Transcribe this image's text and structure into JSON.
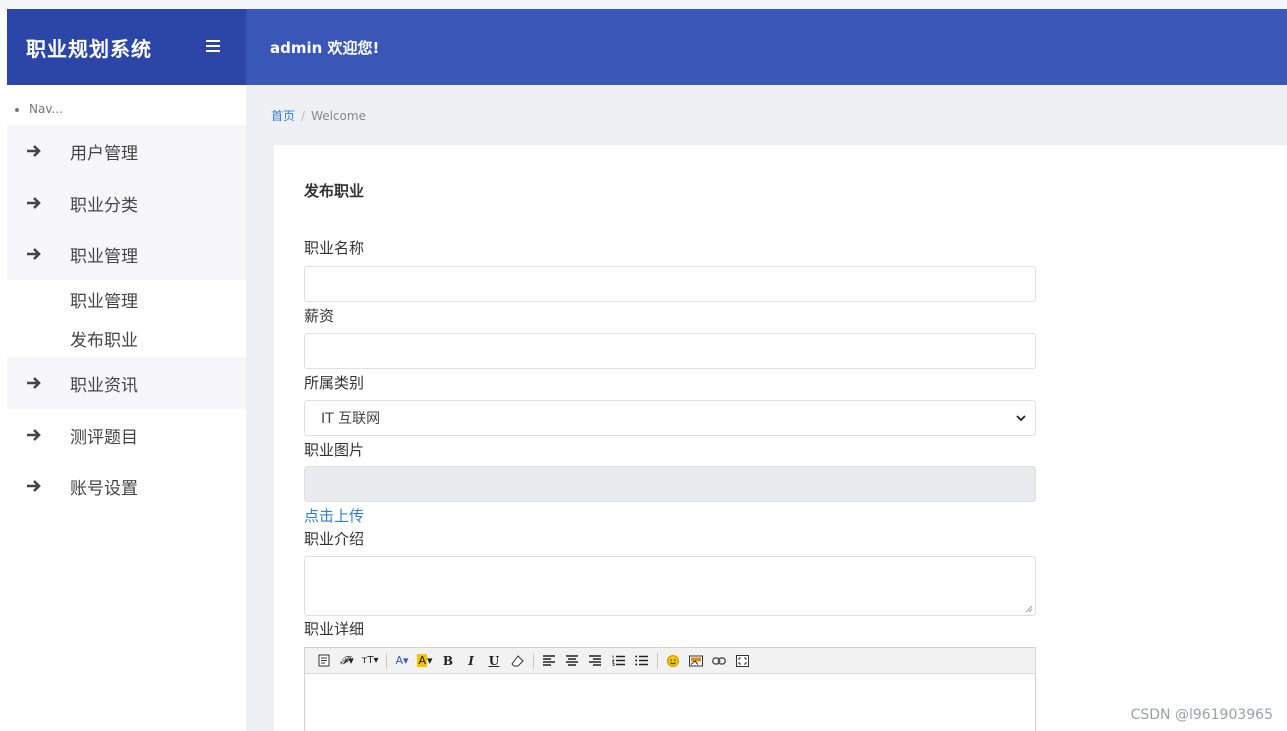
{
  "app": {
    "title": "职业规划系统",
    "welcome": "admin 欢迎您!"
  },
  "sidebar": {
    "nav_title": "Nav...",
    "items": [
      {
        "label": "用户管理"
      },
      {
        "label": "职业分类"
      },
      {
        "label": "职业管理",
        "children": [
          {
            "label": "职业管理"
          },
          {
            "label": "发布职业"
          }
        ]
      },
      {
        "label": "职业资讯"
      },
      {
        "label": "测评题目"
      },
      {
        "label": "账号设置"
      }
    ]
  },
  "breadcrumb": {
    "home": "首页",
    "separator": "/",
    "current": "Welcome"
  },
  "form": {
    "title": "发布职业",
    "fields": {
      "name": {
        "label": "职业名称",
        "value": "",
        "placeholder": ""
      },
      "salary": {
        "label": "薪资",
        "value": "",
        "placeholder": ""
      },
      "category": {
        "label": "所属类别",
        "selected": "IT 互联网"
      },
      "image": {
        "label": "职业图片",
        "value": ""
      },
      "upload_link": "点击上传",
      "intro": {
        "label": "职业介绍",
        "value": ""
      },
      "detail": {
        "label": "职业详细"
      }
    }
  },
  "editor_toolbar": [
    "source-icon",
    "font-family-icon",
    "font-size-icon",
    "font-color-icon",
    "background-color-icon",
    "bold-icon",
    "italic-icon",
    "underline-icon",
    "remove-format-icon",
    "align-left-icon",
    "align-center-icon",
    "align-right-icon",
    "ordered-list-icon",
    "unordered-list-icon",
    "emoticon-icon",
    "image-icon",
    "link-icon",
    "fullscreen-icon"
  ],
  "watermark": "CSDN @l961903965",
  "colors": {
    "brand": "#2c46a8",
    "header": "#3a57b8",
    "link": "#2f7fd8"
  }
}
